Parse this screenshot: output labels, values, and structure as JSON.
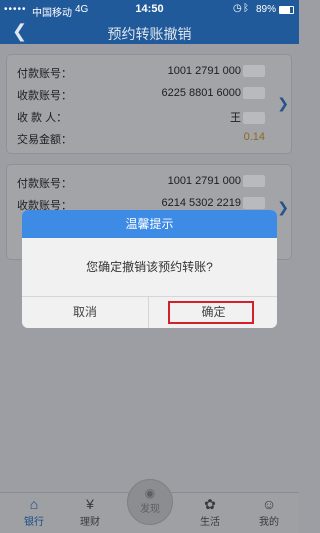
{
  "status_bar": {
    "signal": "•••••",
    "carrier": "中国移动",
    "network": "4G",
    "time": "14:50",
    "battery_percent": "89%",
    "battery_level": 0.89
  },
  "nav": {
    "back_icon": "chevron-left-icon",
    "title": "预约转账撤销"
  },
  "card1": {
    "rows": [
      {
        "label": "付款账号：",
        "value": "1001 2791 000"
      },
      {
        "label": "收款账号：",
        "value": "6225 8801 6000"
      },
      {
        "label": "收 款 人：",
        "value": "王"
      },
      {
        "label": "交易金额：",
        "value": "0.14"
      }
    ]
  },
  "card2": {
    "rows": [
      {
        "label": "付款账号：",
        "value": "1001 2791 000"
      },
      {
        "label": "收款账号：",
        "value": "6214 5302 2219"
      }
    ]
  },
  "dialog": {
    "title": "温馨提示",
    "message": "您确定撤销该预约转账?",
    "cancel_label": "取消",
    "confirm_label": "确定",
    "highlight_color": "#d3202a",
    "header_color": "#3e8be6"
  },
  "tabs": [
    {
      "label": "银行",
      "icon": "home-icon",
      "active": true
    },
    {
      "label": "理财",
      "icon": "money-bag-icon",
      "active": false
    },
    {
      "label": "发现",
      "icon": "eye-icon",
      "active": false
    },
    {
      "label": "生活",
      "icon": "life-icon",
      "active": false
    },
    {
      "label": "我的",
      "icon": "person-icon",
      "active": false
    }
  ]
}
